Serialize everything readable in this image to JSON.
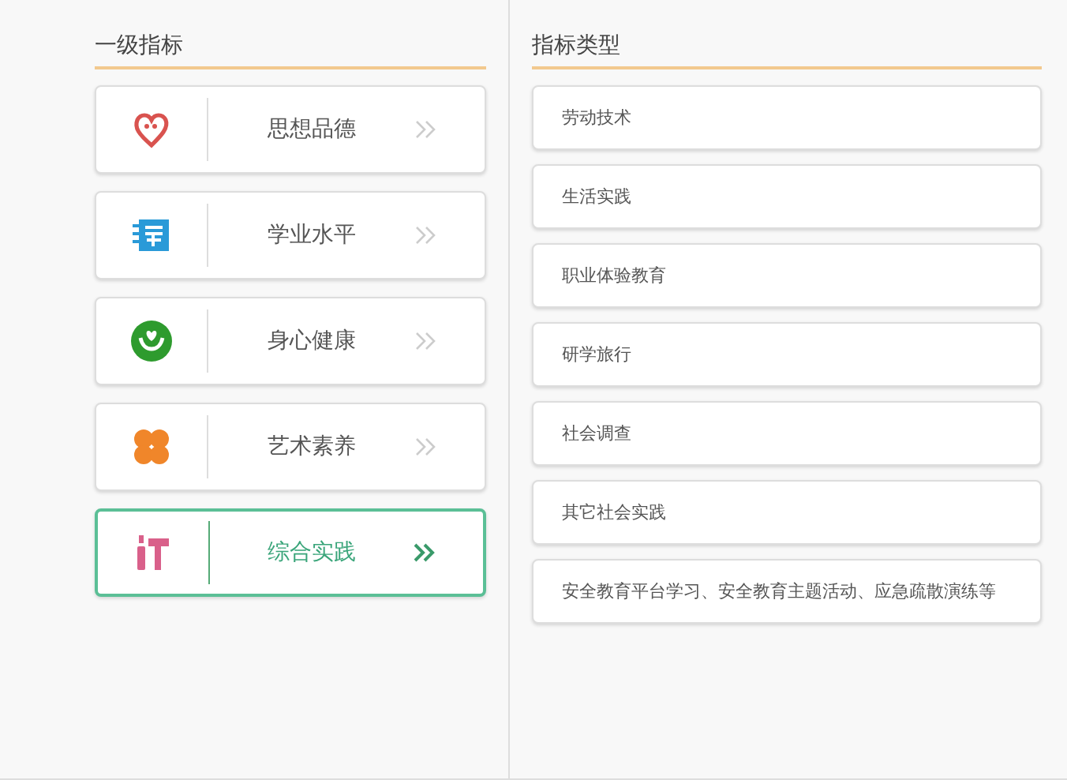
{
  "primary_panel": {
    "title": "一级指标",
    "items": [
      {
        "label": "思想品德",
        "kind": "heart",
        "selected": false
      },
      {
        "label": "学业水平",
        "kind": "book",
        "selected": false
      },
      {
        "label": "身心健康",
        "kind": "hands",
        "selected": false
      },
      {
        "label": "艺术素养",
        "kind": "clover",
        "selected": false
      },
      {
        "label": "综合实践",
        "kind": "tools",
        "selected": true
      }
    ]
  },
  "type_panel": {
    "title": "指标类型",
    "items": [
      {
        "label": "劳动技术"
      },
      {
        "label": "生活实践"
      },
      {
        "label": "职业体验教育"
      },
      {
        "label": "研学旅行"
      },
      {
        "label": "社会调查"
      },
      {
        "label": "其它社会实践"
      },
      {
        "label": "安全教育平台学习、安全教育主题活动、应急疏散演练等"
      }
    ]
  }
}
